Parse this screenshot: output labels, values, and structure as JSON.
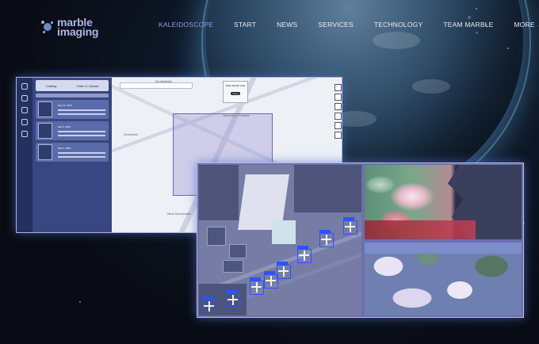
{
  "brand": {
    "name_line1": "marble",
    "name_line2": "imaging",
    "accent_color": "#8e9ee0"
  },
  "nav": {
    "items": [
      {
        "label": "KALEIDOSCOPE",
        "active": true
      },
      {
        "label": "START",
        "active": false
      },
      {
        "label": "NEWS",
        "active": false
      },
      {
        "label": "SERVICES",
        "active": false
      },
      {
        "label": "TECHNOLOGY",
        "active": false
      },
      {
        "label": "TEAM MARBLE",
        "active": false
      },
      {
        "label": "MORE",
        "active": false,
        "icon": "chevron-down-icon"
      }
    ]
  },
  "showcase": {
    "app_screenshot": {
      "description_icon": "kaleidoscope-app-preview",
      "panel_tab_left": "Catalog",
      "panel_tab_right": "Order & Upload",
      "results": [
        {
          "title": "Mar 18, 2025"
        },
        {
          "title": "Mar 9, 2025"
        },
        {
          "title": "Mar 6, 2025"
        }
      ],
      "map_labels": [
        "Alt-Stadtmitte",
        "University of Potsdam",
        "Schönefeld",
        "Neue Schmöckwitz"
      ],
      "dialog_title": "Draw Search Area",
      "dialog_button": "Done"
    },
    "imagery_panels": [
      {
        "icon": "airport-detection-image"
      },
      {
        "icon": "algae-bloom-image"
      },
      {
        "icon": "land-cover-map-image"
      }
    ]
  }
}
